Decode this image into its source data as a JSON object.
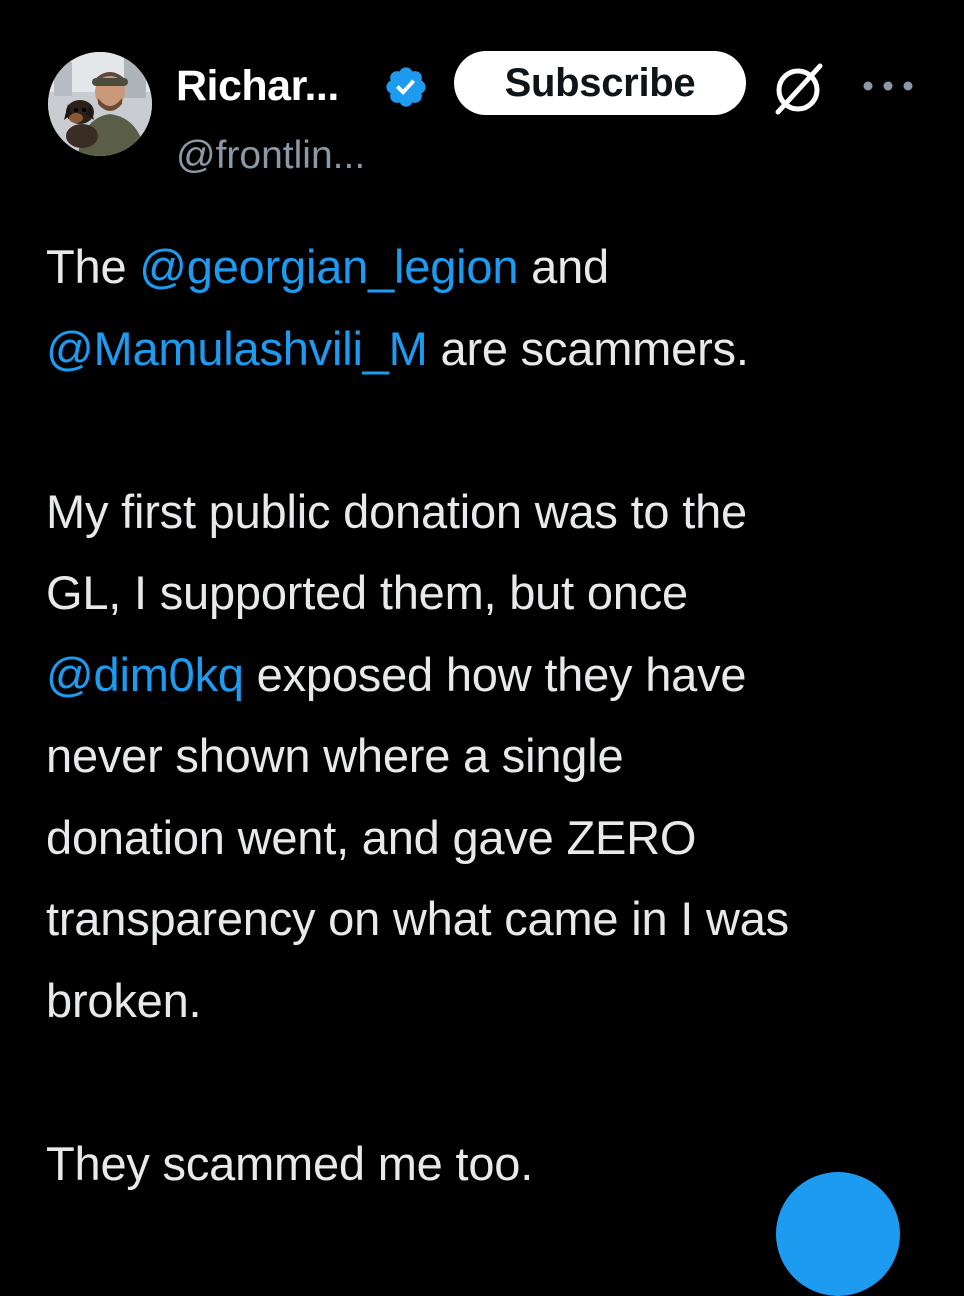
{
  "author": {
    "display_name": "Richar...",
    "handle": "@frontlin...",
    "verified": true,
    "avatar_icon": "profile-photo-man-with-dog"
  },
  "actions": {
    "subscribe_label": "Subscribe",
    "grok_icon": "grok-icon",
    "more_icon": "more-horizontal-icon"
  },
  "colors": {
    "background": "#000000",
    "text": "#e7e9ea",
    "secondary_text": "#8b98a5",
    "mention": "#1d9bf0",
    "verified_badge": "#1d9bf0"
  },
  "tweet": {
    "p1": {
      "l1_a": "The ",
      "l1_mention": "@georgian_legion",
      "l1_b": " and",
      "l2_mention": "@Mamulashvili_M",
      "l2_b": " are scammers."
    },
    "p2": {
      "l1": "My first public donation was to the",
      "l2": "GL, I supported them, but once",
      "l3_mention": "@dim0kq",
      "l3_b": " exposed how they have",
      "l4": "never shown where a single",
      "l5": "donation went, and gave ZERO",
      "l6": "transparency on what came in I was",
      "l7": "broken."
    },
    "p3": {
      "l1": "They scammed me too."
    }
  }
}
